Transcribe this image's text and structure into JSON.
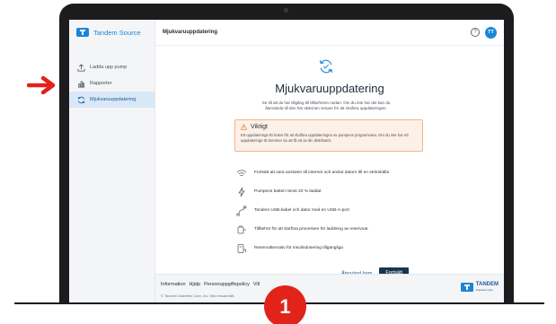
{
  "colors": {
    "accent": "#1a86d9",
    "primary_button": "#16364d",
    "warning_border": "#f2b48a",
    "warning_bg": "#fdf1e7",
    "arrow": "#e2231a",
    "badge": "#e2231a"
  },
  "brand": {
    "name": "Tandem Source",
    "logo_icon": "tandem-logo-icon"
  },
  "sidebar": {
    "items": [
      {
        "label": "Ladda upp pump",
        "icon": "upload-icon",
        "active": false
      },
      {
        "label": "Rapporter",
        "icon": "bar-chart-icon",
        "active": false
      },
      {
        "label": "Mjukvaruuppdatering",
        "icon": "sync-icon",
        "active": true
      }
    ]
  },
  "header": {
    "title": "Mjukvaruuppdatering",
    "help_icon": "help-icon",
    "avatar_initials": "TT"
  },
  "main": {
    "title": "Mjukvaruuppdatering",
    "subtitle": "Se till att du har tillgång till tillbehören nedan. Om du inte har det kan du återvända till den här skärmen senare för att slutföra uppdateringen.",
    "warning": {
      "icon": "warning-icon",
      "title": "Viktigt",
      "text": "Ett uppdaterings-ID krävs för att slutföra uppdateringen av pumpens programvara. Om du inte har ett uppdaterings-ID kommer du att få ett av din distributör."
    },
    "requirements": [
      {
        "icon": "wifi-icon",
        "text": "Fortsätt att vara ansluten till internet och anslut datorn till en strömkälla"
      },
      {
        "icon": "lightning-icon",
        "text": "Pumpens batteri minst 20 % laddat"
      },
      {
        "icon": "usb-cable-icon",
        "text": "Tandem USB-kabel och dator med en USB-A-port"
      },
      {
        "icon": "charger-icon",
        "text": "Tillbehör för att slutföra processen för laddning av reservoar"
      },
      {
        "icon": "pen-device-icon",
        "text": "Reservalternativ för insulindosering tillgängliga"
      }
    ],
    "back_label": "Återvänd hem",
    "next_label": "Fortsätt"
  },
  "footer": {
    "links": [
      "Information",
      "Hjälp",
      "Personuppgiftspolicy",
      "Vill"
    ],
    "copyright": "© Tandem Diabetes Care, Inc. Med ensamrätt.",
    "logo_text": "TANDEM",
    "logo_sub": "Diabetes Care"
  },
  "step_badge": "1"
}
